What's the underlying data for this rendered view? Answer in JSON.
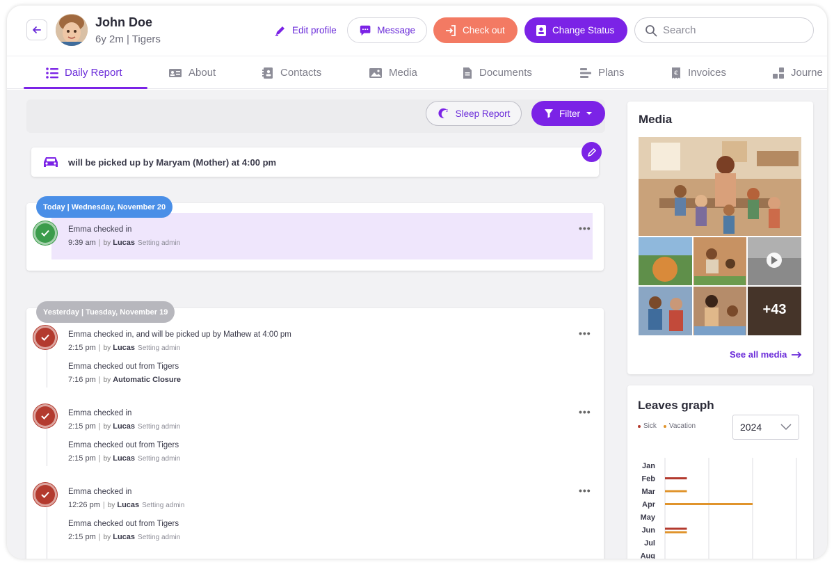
{
  "profile": {
    "name": "John Doe",
    "subtitle": "6y 2m | Tigers"
  },
  "actions": {
    "edit": "Edit profile",
    "message": "Message",
    "checkout": "Check out",
    "status": "Change Status",
    "search_placeholder": "Search"
  },
  "tabs": [
    {
      "label": "Daily Report",
      "icon": "list-icon",
      "active": true
    },
    {
      "label": "About",
      "icon": "id-card-icon"
    },
    {
      "label": "Contacts",
      "icon": "contacts-icon"
    },
    {
      "label": "Media",
      "icon": "image-icon"
    },
    {
      "label": "Documents",
      "icon": "document-icon"
    },
    {
      "label": "Plans",
      "icon": "plans-icon"
    },
    {
      "label": "Invoices",
      "icon": "invoice-icon"
    },
    {
      "label": "Journe",
      "icon": "blocks-icon"
    }
  ],
  "toolbar": {
    "sleep": "Sleep Report",
    "filter": "Filter"
  },
  "pickup": {
    "text": "will be picked up by Maryam (Mother) at 4:00 pm"
  },
  "today": {
    "label": "Today | Wednesday, November 20",
    "entries": [
      {
        "title": "Emma checked in",
        "time": "9:39 am",
        "by": "by",
        "who": "Lucas",
        "role": "Setting admin"
      }
    ]
  },
  "yesterday": {
    "label": "Yesterday | Tuesday, November 19",
    "groups": [
      {
        "in": {
          "title": "Emma checked in, and will be picked up by Mathew at 4:00 pm",
          "time": "2:15 pm",
          "by": "by",
          "who": "Lucas",
          "role": "Setting admin"
        },
        "out": {
          "title": "Emma checked out from Tigers",
          "time": "7:16 pm",
          "by": "by",
          "who": "Automatic Closure",
          "role": ""
        }
      },
      {
        "in": {
          "title": "Emma checked in",
          "time": "2:15 pm",
          "by": "by",
          "who": "Lucas",
          "role": "Setting admin"
        },
        "out": {
          "title": "Emma checked out from Tigers",
          "time": "2:15 pm",
          "by": "by",
          "who": "Lucas",
          "role": "Setting admin"
        }
      },
      {
        "in": {
          "title": "Emma checked in",
          "time": "12:26 pm",
          "by": "by",
          "who": "Lucas",
          "role": "Setting admin"
        },
        "out": {
          "title": "Emma checked out from Tigers",
          "time": "2:15 pm",
          "by": "by",
          "who": "Lucas",
          "role": "Setting admin"
        }
      }
    ]
  },
  "media": {
    "title": "Media",
    "more": "+43",
    "see_all": "See all media"
  },
  "leaves": {
    "title": "Leaves graph",
    "legend": [
      {
        "name": "Sick",
        "color": "#b33a2e"
      },
      {
        "name": "Vacation",
        "color": "#e0942c"
      }
    ],
    "year": "2024"
  },
  "chart_data": {
    "type": "bar",
    "orientation": "horizontal",
    "categories": [
      "Jan",
      "Feb",
      "Mar",
      "Apr",
      "May",
      "Jun",
      "Jul",
      "Aug"
    ],
    "series": [
      {
        "name": "Sick",
        "color": "#b33a2e",
        "values": [
          0,
          1,
          0,
          0,
          0,
          1,
          0,
          0
        ]
      },
      {
        "name": "Vacation",
        "color": "#e0942c",
        "values": [
          0,
          0,
          1,
          4,
          0,
          1,
          0,
          0
        ]
      }
    ],
    "xlim": [
      0,
      6
    ],
    "grid": true
  },
  "colors": {
    "accent": "#7b23e6",
    "checkout": "#f37a63",
    "today_pill": "#4a8fe7",
    "yesterday_pill": "#b7b7bd"
  }
}
